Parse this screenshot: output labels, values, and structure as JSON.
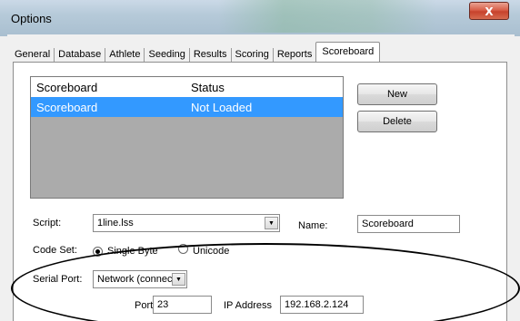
{
  "window": {
    "title": "Options",
    "close_glyph": "X"
  },
  "tabs": [
    "General",
    "Database",
    "Athlete",
    "Seeding",
    "Results",
    "Scoring",
    "Reports",
    "Scoreboard"
  ],
  "active_tab": "Scoreboard",
  "list": {
    "columns": [
      "Scoreboard",
      "Status"
    ],
    "rows": [
      {
        "name": "Scoreboard",
        "status": "Not Loaded",
        "selected": true
      }
    ],
    "selection_color": "#3399ff"
  },
  "buttons": {
    "new": "New",
    "delete": "Delete"
  },
  "script": {
    "label": "Script:",
    "value": "1line.lss"
  },
  "name_field": {
    "label": "Name:",
    "value": "Scoreboard"
  },
  "code_set": {
    "label": "Code Set:",
    "options": [
      "Single Byte",
      "Unicode"
    ],
    "selected": "Single Byte"
  },
  "serial_port": {
    "label": "Serial Port:",
    "value": "Network (connect"
  },
  "port": {
    "label": "Port",
    "value": "23"
  },
  "ip_address": {
    "label": "IP Address",
    "value": "192.168.2.124"
  },
  "icons": {
    "close": "close-icon",
    "dropdown": "chevron-down-icon"
  }
}
